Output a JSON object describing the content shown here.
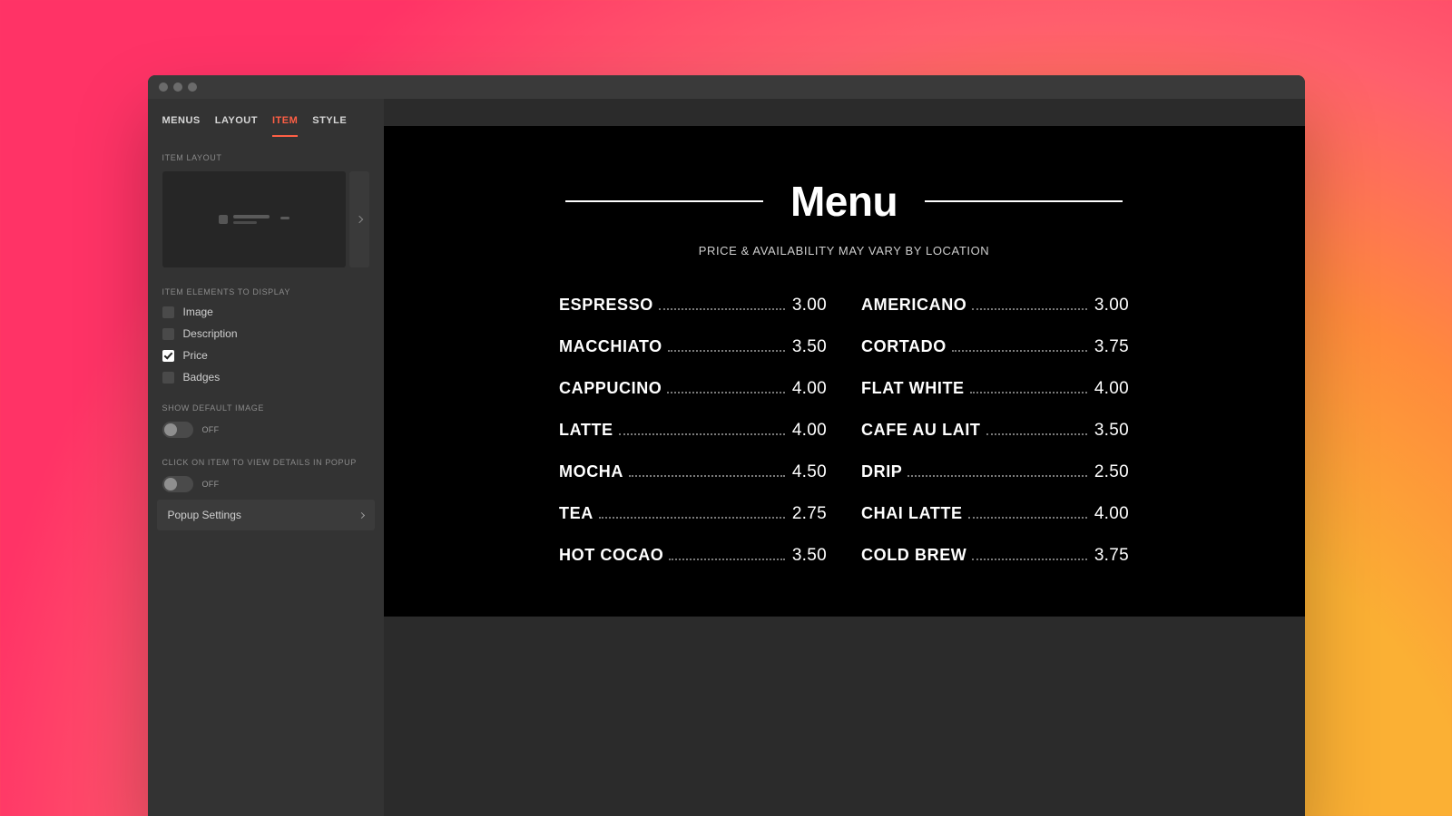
{
  "sidebar": {
    "tabs": [
      "MENUS",
      "LAYOUT",
      "ITEM",
      "STYLE"
    ],
    "active_tab_index": 2,
    "section_item_layout": "ITEM LAYOUT",
    "section_elements": "ITEM ELEMENTS TO DISPLAY",
    "elements": [
      {
        "label": "Image",
        "checked": false
      },
      {
        "label": "Description",
        "checked": false
      },
      {
        "label": "Price",
        "checked": true
      },
      {
        "label": "Badges",
        "checked": false
      }
    ],
    "section_default_image": "SHOW DEFAULT IMAGE",
    "default_image_toggle": {
      "state_label": "OFF",
      "on": false
    },
    "section_popup": "CLICK ON ITEM TO VIEW DETAILS IN POPUP",
    "popup_toggle": {
      "state_label": "OFF",
      "on": false
    },
    "popup_settings_label": "Popup Settings"
  },
  "menu": {
    "title": "Menu",
    "subtitle": "PRICE & AVAILABILITY MAY VARY BY LOCATION",
    "columns": [
      [
        {
          "name": "ESPRESSO",
          "price": "3.00"
        },
        {
          "name": "MACCHIATO",
          "price": "3.50"
        },
        {
          "name": "CAPPUCINO",
          "price": "4.00"
        },
        {
          "name": "LATTE",
          "price": "4.00"
        },
        {
          "name": "MOCHA",
          "price": "4.50"
        },
        {
          "name": "TEA",
          "price": "2.75"
        },
        {
          "name": "HOT COCAO",
          "price": "3.50"
        }
      ],
      [
        {
          "name": "AMERICANO",
          "price": "3.00"
        },
        {
          "name": "CORTADO",
          "price": "3.75"
        },
        {
          "name": "FLAT WHITE",
          "price": "4.00"
        },
        {
          "name": "CAFE AU LAIT",
          "price": "3.50"
        },
        {
          "name": "DRIP",
          "price": "2.50"
        },
        {
          "name": "CHAI LATTE",
          "price": "4.00"
        },
        {
          "name": "COLD BREW",
          "price": "3.75"
        }
      ]
    ]
  }
}
